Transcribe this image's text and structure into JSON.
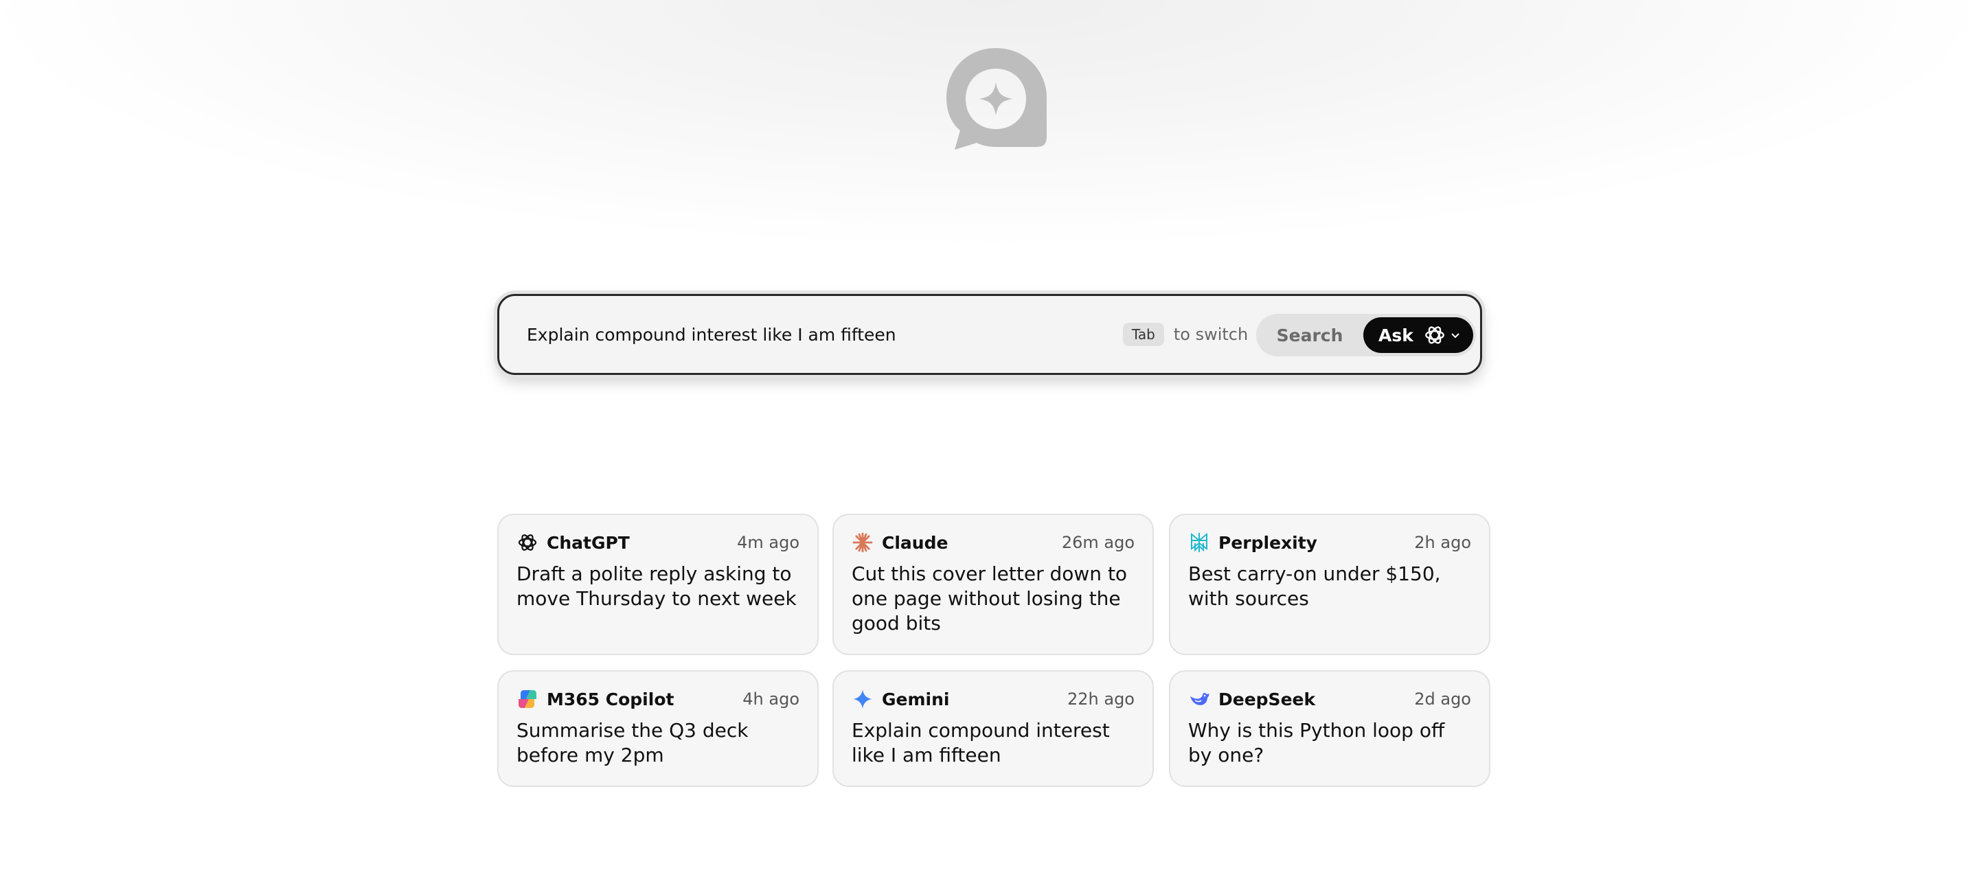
{
  "search": {
    "value": "Explain compound interest like I am fifteen",
    "tab_key": "Tab",
    "tab_hint": "to switch",
    "mode_search_label": "Search",
    "mode_ask_label": "Ask",
    "selected_model_icon": "chatgpt-icon"
  },
  "logo": {
    "icon": "chat-bubble-sparkle-logo",
    "color": "#bdbdbd"
  },
  "recent": [
    {
      "app": "ChatGPT",
      "time": "4m ago",
      "text": "Draft a polite reply asking to move Thursday to next week",
      "icon": "chatgpt-icon"
    },
    {
      "app": "Claude",
      "time": "26m ago",
      "text": "Cut this cover letter down to one page without losing the good bits",
      "icon": "claude-icon"
    },
    {
      "app": "Perplexity",
      "time": "2h ago",
      "text": "Best carry-on under $150, with sources",
      "icon": "perplexity-icon"
    },
    {
      "app": "M365 Copilot",
      "time": "4h ago",
      "text": "Summarise the Q3 deck before my 2pm",
      "icon": "copilot-icon"
    },
    {
      "app": "Gemini",
      "time": "22h ago",
      "text": "Explain compound interest like I am fifteen",
      "icon": "gemini-icon"
    },
    {
      "app": "DeepSeek",
      "time": "2d ago",
      "text": "Why is this Python loop off by one?",
      "icon": "deepseek-icon"
    }
  ],
  "colors": {
    "ask_button": "#0b0b0b",
    "claude": "#d97757",
    "perplexity": "#20b8cd",
    "gemini": "#4285f4",
    "deepseek": "#4d6bfe"
  }
}
